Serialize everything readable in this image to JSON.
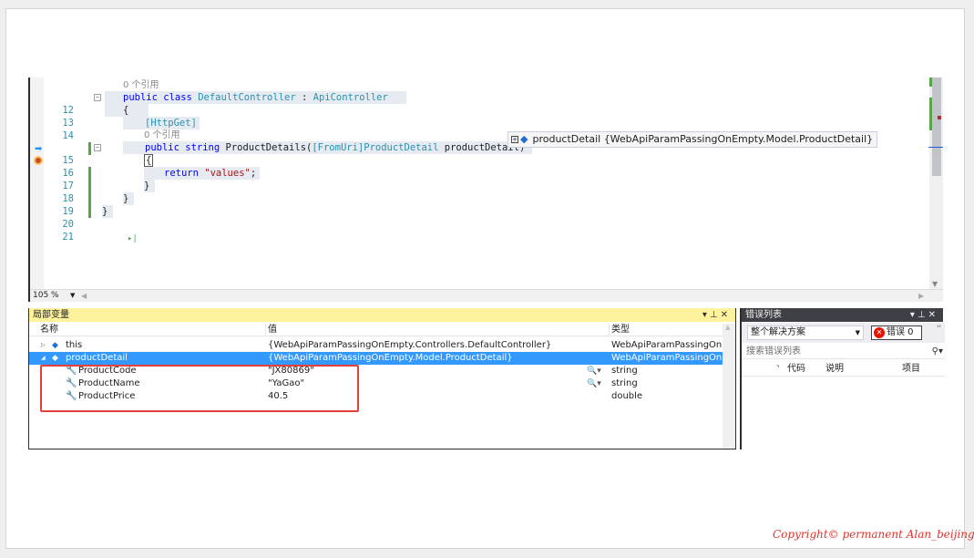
{
  "editor": {
    "lines": [
      {
        "num": "",
        "codelens": "0 个引用"
      },
      {
        "num": "12",
        "kw": "public class ",
        "type": "DefaultController",
        "rest": " : ",
        "base": "ApiController"
      },
      {
        "num": "13",
        "text": "{"
      },
      {
        "num": "14",
        "attr": "[HttpGet]"
      },
      {
        "num": "",
        "codelens": "0 个引用"
      },
      {
        "num": "15",
        "kw": "public string ",
        "method": "ProductDetails(",
        "attr2": "[FromUri]",
        "ptype": "ProductDetail",
        "pname": " productDetail)"
      },
      {
        "num": "16",
        "text": "{"
      },
      {
        "num": "17",
        "kw": "return ",
        "str": "\"values\"",
        "end": ";"
      },
      {
        "num": "18",
        "text": "}"
      },
      {
        "num": "19",
        "text": "}"
      },
      {
        "num": "20",
        "text": "}"
      },
      {
        "num": "21",
        "text": ""
      }
    ],
    "datatip": {
      "name": "productDetail",
      "value": "{WebApiParamPassingOnEmpty.Model.ProductDetail}"
    },
    "zoom": "105 %"
  },
  "locals": {
    "title": "局部变量",
    "columns": {
      "name": "名称",
      "value": "值",
      "type": "类型"
    },
    "rows": [
      {
        "name": "this",
        "value": "{WebApiParamPassingOnEmpty.Controllers.DefaultController}",
        "type": "WebApiParamPassingOnEm"
      },
      {
        "name": "productDetail",
        "value": "{WebApiParamPassingOnEmpty.Model.ProductDetail}",
        "type": "WebApiParamPassingOnEm"
      },
      {
        "name": "ProductCode",
        "value": "\"JX80869\"",
        "type": "string"
      },
      {
        "name": "ProductName",
        "value": "\"YaGao\"",
        "type": "string"
      },
      {
        "name": "ProductPrice",
        "value": "40.5",
        "type": "double"
      }
    ]
  },
  "errors": {
    "title": "错误列表",
    "scope": "整个解决方案",
    "filter_label": "错误 0",
    "search_placeholder": "搜索错误列表",
    "columns": {
      "code": "代码",
      "desc": "说明",
      "project": "项目"
    }
  },
  "colors": {
    "highlight_row": "#3399ff",
    "panel_title": "#fff29d",
    "annotation_box": "#e5403a"
  },
  "icons": [
    "breakpoint-icon",
    "instruction-pointer-icon",
    "wrench-icon",
    "magnifier-icon",
    "object-icon",
    "error-icon"
  ],
  "watermark": "Copyright© permanent  Alan_beijing"
}
